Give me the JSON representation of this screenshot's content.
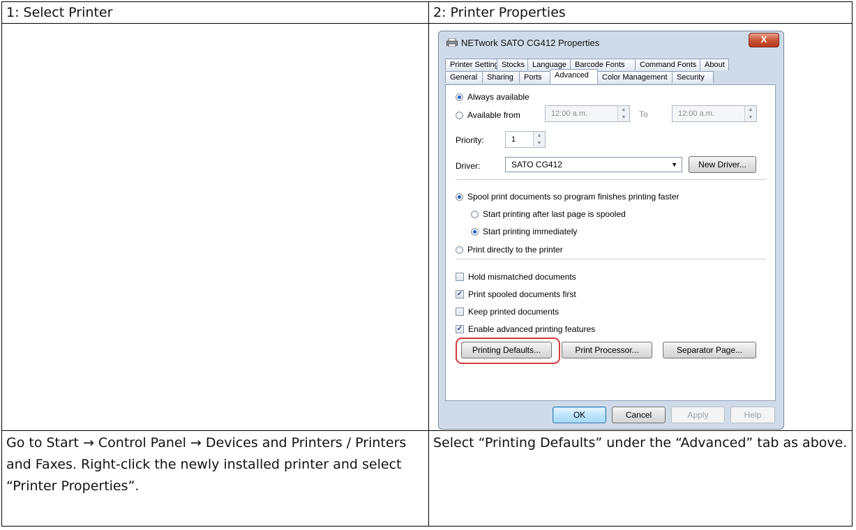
{
  "table": {
    "header_left": "1:  Select Printer",
    "header_right": "2: Printer Properties",
    "desc_left": "Go to Start → Control Panel → Devices and Printers / Printers and Faxes. Right-click the newly installed printer and select “Printer Properties”.",
    "desc_right": "Select “Printing Defaults” under the “Advanced” tab as above."
  },
  "dialog": {
    "title": "NETwork SATO CG412 Properties",
    "close_label": "X",
    "tabs_row1": [
      "Printer Settings",
      "Stocks",
      "Language",
      "Barcode Fonts",
      "Command Fonts",
      "About"
    ],
    "tabs_row2": [
      "General",
      "Sharing",
      "Ports",
      "Advanced",
      "Color Management",
      "Security"
    ],
    "active_tab": "Advanced",
    "availability": {
      "always": "Always available",
      "from": "Available from",
      "from_time": "12:00 a.m.",
      "to_label": "To",
      "to_time": "12:00 a.m."
    },
    "priority": {
      "label": "Priority:",
      "value": "1"
    },
    "driver": {
      "label": "Driver:",
      "value": "SATO CG412",
      "new_driver": "New Driver..."
    },
    "spool": {
      "spool": "Spool print documents so program finishes printing faster",
      "after_last": "Start printing after last page is spooled",
      "immediately": "Start printing immediately",
      "direct": "Print directly to the printer"
    },
    "checks": {
      "hold": "Hold mismatched documents",
      "spooled_first": "Print spooled documents first",
      "keep": "Keep printed documents",
      "advanced": "Enable advanced printing features"
    },
    "buttons": {
      "printing_defaults": "Printing Defaults...",
      "print_processor": "Print Processor...",
      "separator_page": "Separator Page...",
      "ok": "OK",
      "cancel": "Cancel",
      "apply": "Apply",
      "help": "Help"
    }
  }
}
